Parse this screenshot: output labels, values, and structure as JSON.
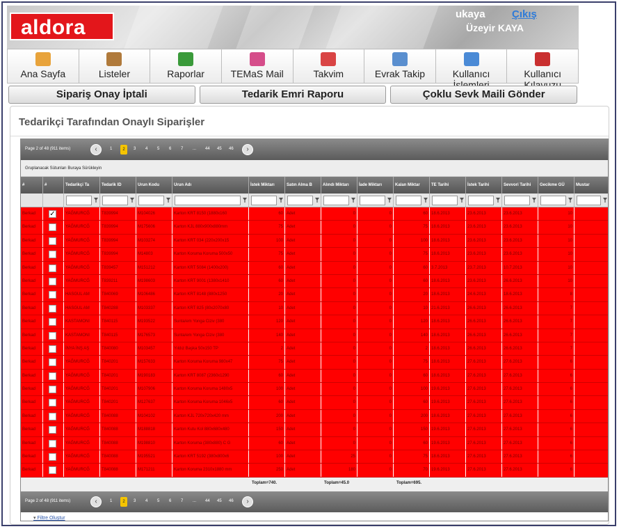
{
  "header": {
    "logo": "aldora",
    "username": "ukaya",
    "logout": "Çıkış",
    "fullname": "Üzeyir KAYA"
  },
  "menu": [
    {
      "label": "Ana Sayfa",
      "icon": "home-icon",
      "color": "#e8a33b"
    },
    {
      "label": "Listeler",
      "icon": "signpost-icon",
      "color": "#b07a3b"
    },
    {
      "label": "Raporlar",
      "icon": "bar-chart-icon",
      "color": "#3a9a3a"
    },
    {
      "label": "TEMaS Mail",
      "icon": "mail-icon",
      "color": "#d54d8a"
    },
    {
      "label": "Takvim",
      "icon": "calendar-icon",
      "color": "#d94444"
    },
    {
      "label": "Evrak Takip",
      "icon": "document-icon",
      "color": "#5a8fcf"
    },
    {
      "label": "Kullanıcı İşlemleri",
      "icon": "user-icon",
      "color": "#4a8ad6"
    },
    {
      "label": "Kullanıcı Kılavuzu",
      "icon": "pdf-icon",
      "color": "#c92f2f"
    }
  ],
  "actions": [
    "Sipariş Onay İptali",
    "Tedarik Emri Raporu",
    "Çoklu Sevk Maili Gönder"
  ],
  "panel_title": "Tedarikçi Tarafından Onaylı Siparişler",
  "pager": {
    "info": "Page 2 of 48 (911 items)",
    "pages": [
      "1",
      "2",
      "3",
      "4",
      "5",
      "6",
      "7",
      "...",
      "44",
      "45",
      "46"
    ],
    "current": "2"
  },
  "group_hint": "Gruplanacak Sütunları Buraya Sürükleyin",
  "columns": [
    "#",
    "#",
    "Tedarikçi Ta",
    "Tedarik ID",
    "Urun Kodu",
    "Urun Adı",
    "İstek Miktarı",
    "Satın Alma B",
    "Alındı Miktarı",
    "İade Miktarı",
    "Kalan Miktar",
    "TE Tarihi",
    "İstek Tarihi",
    "Sevvori Tarihi",
    "Gecikme GÜ",
    "Mustar"
  ],
  "rows": [
    [
      "Berkad",
      true,
      "YAĞMURCĞ",
      "T839994",
      "M104026",
      "Karton KRT 8150 (1880x160",
      "60",
      "Adet",
      "0",
      "0",
      "60",
      "18.6.2013",
      "23.6.2013",
      "23.6.2013",
      "10",
      ""
    ],
    [
      "Berkad",
      false,
      "YAĞMURCĞ",
      "T839994",
      "M175606",
      "Karton KJL 880x900x880mm",
      "75",
      "Adet",
      "0",
      "0",
      "75",
      "18.6.2013",
      "23.6.2013",
      "23.6.2013",
      "10",
      ""
    ],
    [
      "Berkad",
      false,
      "YAĞMURCĞ",
      "T839994",
      "M103274",
      "Karton KRT 034 (220x200x15",
      "100",
      "Adet",
      "0",
      "0",
      "100",
      "18.6.2013",
      "23.6.2013",
      "23.6.2013",
      "10",
      ""
    ],
    [
      "Berkad",
      false,
      "YAĞMURCĞ",
      "T839994",
      "M14803",
      "Karton Koruma Koruma 500x50",
      "75",
      "Adet",
      "0",
      "0",
      "75",
      "18.6.2013",
      "23.6.2013",
      "23.6.2013",
      "10",
      ""
    ],
    [
      "Berkad",
      false,
      "YAĞMURCĞ",
      "T839457",
      "M151212",
      "Karton KRT 5084 (1400x200)",
      "60",
      "Adet",
      "0",
      "0",
      "60",
      "3.7.2013",
      "23.7.2013",
      "10.7.2013",
      "10",
      ""
    ],
    [
      "Berkad",
      false,
      "YAĞMURCĞ",
      "T839211",
      "M198603",
      "Karton KRT 9001 (1380x1410",
      "60",
      "Adet",
      "0",
      "0",
      "60",
      "18.6.2013",
      "23.6.2013",
      "26.6.2013",
      "10",
      ""
    ],
    [
      "Berkad",
      false,
      "HASGUL AM",
      "T840069",
      "M106486",
      "Karton KRT 8148 (880x1250",
      "20",
      "Adet",
      "0",
      "0",
      "20",
      "18.6.2013",
      "24.6.2013",
      "18.6.2013",
      "8",
      ""
    ],
    [
      "Berkad",
      false,
      "HASGUL AM",
      "T840288",
      "M103337",
      "Karton KRT 825 (80x2070x80",
      "10",
      "Adet",
      "0",
      "0",
      "10",
      "21.6.2013",
      "26.6.2013",
      "26.6.2013",
      "7",
      ""
    ],
    [
      "Berkad",
      false,
      "KASTAMONI",
      "T840115",
      "M193522",
      "Sunta/em Yonga Ciziv (380",
      "120",
      "Adet",
      "0",
      "0",
      "120",
      "18.6.2013",
      "26.6.2013",
      "26.6.2013",
      "7",
      ""
    ],
    [
      "Berkad",
      false,
      "KASTAMONI",
      "T840115",
      "M176573",
      "Sunta/em Yonga Ciziv (380",
      "140",
      "Adet",
      "0",
      "0",
      "140",
      "18.6.2013",
      "26.6.2013",
      "26.6.2013",
      "7",
      ""
    ],
    [
      "Berkad",
      false,
      "İNYA İNŞ AŞ",
      "T840080",
      "M103457",
      "Yıldız Başka 50x150 TP",
      "2",
      "Adet",
      "0",
      "0",
      "2",
      "18.6.2013",
      "26.6.2013",
      "26.6.2013",
      "7",
      ""
    ],
    [
      "Berkad",
      false,
      "YAĞMURCĞ",
      "T840201",
      "M157633",
      "Karton Koruma Koruma 980x47",
      "75",
      "Adet",
      "0",
      "0",
      "75",
      "18.6.2013",
      "27.6.2013",
      "27.6.2013",
      "6",
      ""
    ],
    [
      "Berkad",
      false,
      "YAĞMURCĞ",
      "T840201",
      "M190183",
      "Karton KRT 8087 (2360x1290",
      "60",
      "Adet",
      "0",
      "0",
      "60",
      "18.6.2013",
      "27.6.2013",
      "27.6.2013",
      "6",
      ""
    ],
    [
      "Berkad",
      false,
      "YAĞMURCĞ",
      "T840201",
      "M107906",
      "Karton Koruma Koruma 1480x5",
      "100",
      "Adet",
      "0",
      "0",
      "100",
      "19.6.2013",
      "27.6.2013",
      "27.6.2013",
      "6",
      ""
    ],
    [
      "Berkad",
      false,
      "YAĞMURCĞ",
      "T840201",
      "M127637",
      "Karton Koruma Koruma 1046x5",
      "60",
      "Adet",
      "0",
      "0",
      "60",
      "19.6.2013",
      "27.6.2013",
      "27.6.2013",
      "6",
      ""
    ],
    [
      "Berkad",
      false,
      "YAĞMURCĞ",
      "T840088",
      "M104102",
      "Karton KJL 720x720x420 mm",
      "200",
      "Adet",
      "0",
      "0",
      "200",
      "18.6.2013",
      "27.6.2013",
      "27.6.2013",
      "6",
      ""
    ],
    [
      "Berkad",
      false,
      "YAĞMURCĞ",
      "T840088",
      "M188818",
      "Karton Kutu Kol 880x680x480",
      "150",
      "Adet",
      "0",
      "0",
      "150",
      "19.6.2013",
      "27.6.2013",
      "27.6.2013",
      "6",
      ""
    ],
    [
      "Berkad",
      false,
      "YAĞMURCĞ",
      "T840088",
      "M198810",
      "Karton Koruma (380x880) C G",
      "60",
      "Adet",
      "0",
      "0",
      "60",
      "19.6.2013",
      "27.6.2013",
      "27.6.2013",
      "6",
      ""
    ],
    [
      "Berkad",
      false,
      "YAĞMURCĞ",
      "T840088",
      "M195521",
      "Karton KRT 5192 (380x800x6",
      "100",
      "Adet",
      "25",
      "0",
      "75",
      "18.6.2013",
      "27.6.2013",
      "27.6.2013",
      "6",
      ""
    ],
    [
      "Berkad",
      false,
      "YAĞMURCĞ",
      "T840088",
      "M171211",
      "Karton Koruma 2310x1880 mm",
      "250",
      "Adet",
      "180",
      "0",
      "70",
      "19.6.2013",
      "27.6.2013",
      "27.6.2013",
      "6",
      ""
    ]
  ],
  "totals": [
    "Toplam=740.",
    "Toplam=45.0",
    "Toplam=695."
  ],
  "filter_link": "Filtre Oluştur"
}
